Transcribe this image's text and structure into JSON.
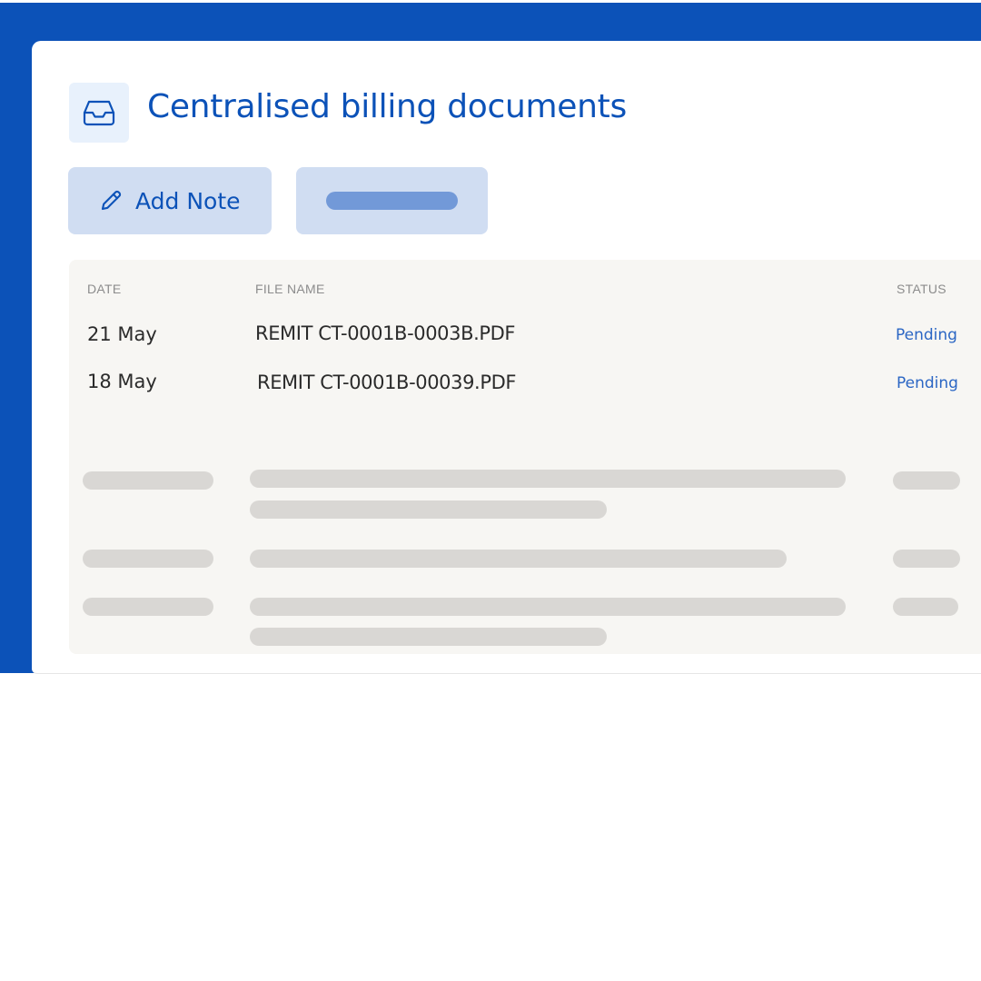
{
  "header": {
    "title": "Centralised billing documents",
    "icon": "inbox-tray-icon"
  },
  "toolbar": {
    "add_note_label": "Add Note",
    "add_note_icon": "pencil-icon"
  },
  "table": {
    "columns": {
      "date": "DATE",
      "file_name": "FILE NAME",
      "status": "STATUS"
    },
    "rows": [
      {
        "date": "21 May",
        "file_name": "REMIT CT-0001B-0003B.PDF",
        "status": "Pending"
      },
      {
        "date": "18 May",
        "file_name": "REMIT CT-0001B-00039.PDF",
        "status": "Pending"
      }
    ]
  },
  "colors": {
    "brand_blue": "#0c52b8",
    "status_blue": "#2b66c4",
    "button_bg": "#d0ddf2",
    "panel_bg": "#f7f6f3",
    "skeleton": "#d9d7d4"
  }
}
